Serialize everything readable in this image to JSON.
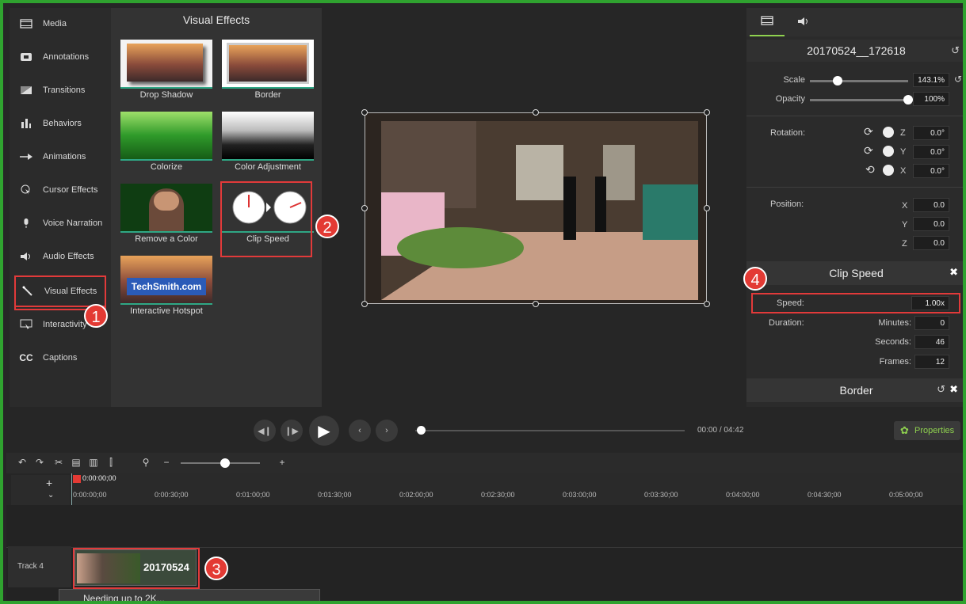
{
  "colors": {
    "accent_green": "#2fa22f",
    "callout_red": "#e33a34",
    "highlight_teal": "#2fa785"
  },
  "sidebar": {
    "items": [
      {
        "label": "Media",
        "icon": "film-icon"
      },
      {
        "label": "Annotations",
        "icon": "annotation-icon"
      },
      {
        "label": "Transitions",
        "icon": "transition-icon"
      },
      {
        "label": "Behaviors",
        "icon": "behaviors-icon"
      },
      {
        "label": "Animations",
        "icon": "animation-arrow-icon"
      },
      {
        "label": "Cursor Effects",
        "icon": "cursor-icon"
      },
      {
        "label": "Voice Narration",
        "icon": "microphone-icon"
      },
      {
        "label": "Audio Effects",
        "icon": "speaker-icon"
      },
      {
        "label": "Visual Effects",
        "icon": "magic-wand-icon"
      },
      {
        "label": "Interactivity",
        "icon": "interactivity-icon"
      },
      {
        "label": "Captions",
        "icon": "cc-icon"
      }
    ]
  },
  "effects": {
    "title": "Visual Effects",
    "tiles": [
      {
        "label": "Drop Shadow"
      },
      {
        "label": "Border"
      },
      {
        "label": "Colorize"
      },
      {
        "label": "Color Adjustment"
      },
      {
        "label": "Remove a Color"
      },
      {
        "label": "Clip Speed"
      },
      {
        "label": "Interactive Hotspot",
        "overlay": "TechSmith.com"
      }
    ]
  },
  "properties": {
    "clip_name": "20170524__172618",
    "scale_label": "Scale",
    "scale_value": "143.1%",
    "scale_level": 0.28,
    "opacity_label": "Opacity",
    "opacity_value": "100%",
    "opacity_level": 1.0,
    "rotation_label": "Rotation:",
    "rotation": [
      {
        "axis": "Z",
        "value": "0.0°"
      },
      {
        "axis": "Y",
        "value": "0.0°"
      },
      {
        "axis": "X",
        "value": "0.0°"
      }
    ],
    "position_label": "Position:",
    "position": [
      {
        "axis": "X",
        "value": "0.0"
      },
      {
        "axis": "Y",
        "value": "0.0"
      },
      {
        "axis": "Z",
        "value": "0.0"
      }
    ],
    "clip_speed": {
      "title": "Clip Speed",
      "speed_label": "Speed:",
      "speed_value": "1.00x",
      "duration_label": "Duration:",
      "minutes_label": "Minutes:",
      "minutes_value": "0",
      "seconds_label": "Seconds:",
      "seconds_value": "46",
      "frames_label": "Frames:",
      "frames_value": "12"
    },
    "border_title": "Border"
  },
  "playback": {
    "time_current": "00:00",
    "time_sep": "/",
    "time_total": "04:42",
    "properties_label": "Properties"
  },
  "timeline": {
    "playhead": "0:00:00;00",
    "ticks": [
      "0:00:00;00",
      "0:00:30;00",
      "0:01:00;00",
      "0:01:30;00",
      "0:02:00;00",
      "0:02:30;00",
      "0:03:00;00",
      "0:03:30;00",
      "0:04:00;00",
      "0:04:30;00",
      "0:05:00;00"
    ],
    "track_label": "Track 4",
    "clip_label": "20170524",
    "popup_text": "Needing up to 2K..."
  },
  "callouts": [
    "1",
    "2",
    "3",
    "4"
  ]
}
